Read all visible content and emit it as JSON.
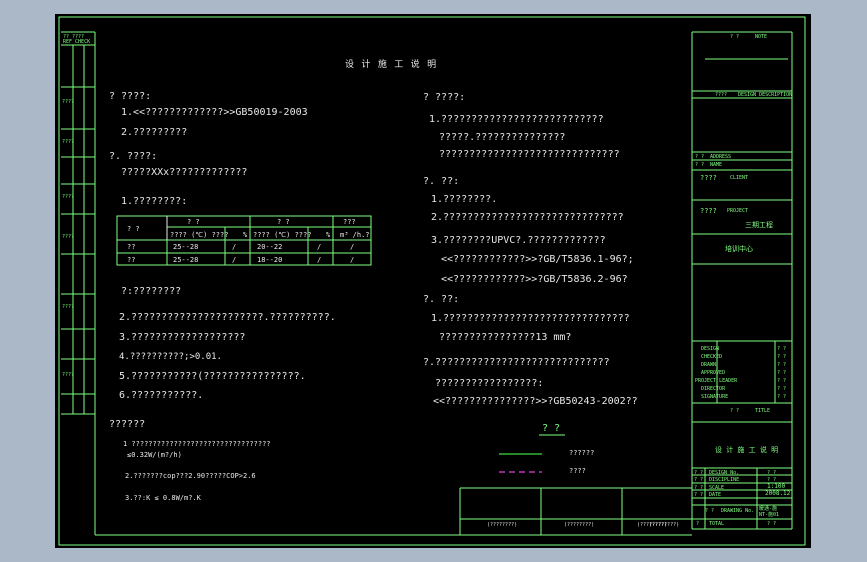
{
  "colors": {
    "frame": "#7fff7f",
    "text": "#e8e8e8",
    "canvas": "#000000",
    "surround": "#abb8c7",
    "legend_green": "#3fd93f",
    "legend_magenta": "#e040e0"
  },
  "drawing_title": "设 计 施 工 说 明",
  "left_column": {
    "s1_heading": "?  ????:",
    "s1_item1": "1.<<?????????????>>GB50019-2003",
    "s1_item2": "2.?????????",
    "s2_heading": "?. ????:",
    "s2_line": "?????XXx?????????????",
    "s2_item1": "1.????????:",
    "table": {
      "corner": "?    ?",
      "group1": "?     ?",
      "group2": "?      ?",
      "group3": "???",
      "sub1": "????  (℃) ????",
      "sub1b": "%",
      "sub2": "????  (℃) ????",
      "sub2b": "%",
      "sub3": "m³ /h.?",
      "rows": [
        {
          "name": "??",
          "v1": "25--28",
          "v2": "/",
          "v3": "20--22",
          "v4": "/",
          "v5": "/"
        },
        {
          "name": "??",
          "v1": "25--28",
          "v2": "/",
          "v3": "18--20",
          "v4": "/",
          "v5": "/"
        }
      ]
    },
    "note1": "?:????????",
    "n2": "2.??????????????????????.??????????.",
    "n3": "3.???????????????????",
    "n4": "4.??????????;>0.01.",
    "n5": "5.???????????(????????????????.",
    "n6": "6.???????????.",
    "s3_heading": "??????",
    "s3_1": "1   ?????????????????????????????????",
    "s3_1b": "≤0.32W/(m?/h)",
    "s3_2": "2.???????cop???2.90?????COP>2.6",
    "s3_3": "3.??:K  ≤  0.8W/m?.K"
  },
  "right_column": {
    "r1_heading": "?  ????:",
    "r1_1": "1.???????????????????????????",
    "r1_1b": "?????.???????????????",
    "r1_1c": "??????????????????????????????",
    "r2_heading": "?.  ??:",
    "r2_1": "1.????????.",
    "r2_2": "2.??????????????????????????????",
    "r2_3": "3.????????UPVC?.?????????????",
    "r2_3a": "<<????????????>>?GB/T5836.1-96?;",
    "r2_3b": "<<????????????>>?GB/T5836.2-96?",
    "r3_heading": "?.  ??:",
    "r3_1": "1.???????????????????????????????",
    "r3_1b": "????????????????13  mm?",
    "r4_heading": "?.?????????????????????????????",
    "r4_a": "?????????????????:",
    "r4_b": "<<???????????????>>?GB50243-2002??",
    "legend_title": "?  ?",
    "legend_1": "??????",
    "legend_2": "????"
  },
  "bottom_boxes": [
    "(????????)",
    "(????????)",
    "(????????)",
    "(????????)"
  ],
  "title_block": {
    "top_label": "?  ?",
    "top_label_small": "NOTE",
    "design_label": "????",
    "design_label_small": "DESIGN DESCRIPTION",
    "rows_a": [
      {
        "l": "?  ?",
        "s": "ADDRESS"
      },
      {
        "l": "?  ?",
        "s": "NAME"
      }
    ],
    "client_label": "????",
    "client_small": "CLIENT",
    "project_label": "????",
    "project_small": "PROJECT",
    "project_value": "三期工程",
    "subproject": "培训中心",
    "sign_rows": [
      {
        "s": "DESIGN",
        "v": "?  ?"
      },
      {
        "s": "CHECKED",
        "v": "?  ?"
      },
      {
        "s": "DRAWN",
        "v": "?  ?"
      },
      {
        "s": "APPROVED",
        "v": "?  ?"
      },
      {
        "s": "PROJECT LEADER",
        "v": "?  ?"
      },
      {
        "s": "DIRECTOR",
        "v": "?  ?"
      },
      {
        "s": "SIGNATURE",
        "v": "?  ?"
      }
    ],
    "title_label": "?  ?",
    "title_small": "TITLE",
    "title_value": "设 计 施 工 说 明",
    "info": [
      {
        "l": "? ?",
        "s": "DESIGN No.",
        "v": "?  ?"
      },
      {
        "l": "? ?",
        "s": "DISCIPLINE",
        "v": "?  ?"
      },
      {
        "l": "? ?",
        "s": "SCALE",
        "v": "1:100"
      },
      {
        "l": "? ?",
        "s": "DATE",
        "v": "2008.12"
      }
    ],
    "drawing_no_label": "?   ?",
    "drawing_no_small": "DRAWING No.",
    "drawing_no_value1": "暖通-施",
    "drawing_no_value2": "NT-施01",
    "footer": [
      {
        "l": "?",
        "s": "TOTAL",
        "v": "?  ?"
      },
      {
        "l": "?",
        "s": "SHEET",
        "v": "?  ?"
      }
    ]
  },
  "left_strip": {
    "header": "?? ????",
    "header_small": "REF CHECK",
    "labels": [
      "????",
      "????",
      "????",
      "????",
      "????",
      "????"
    ]
  }
}
